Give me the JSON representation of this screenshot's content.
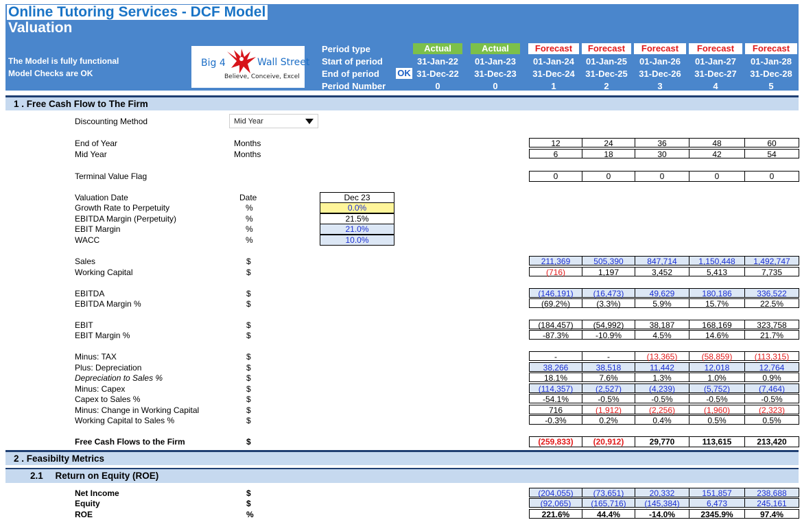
{
  "header": {
    "title": "Online Tutoring Services - DCF Model",
    "subtitle": "Valuation",
    "notes": [
      "The Model is fully functional",
      "Model Checks are OK"
    ],
    "logo": {
      "line1a": "Big 4",
      "line1b": "Wall Street",
      "tagline": "Believe, Conceive, Excel",
      "mark": "eagle-icon"
    },
    "ok_badge": "OK",
    "period_labels": {
      "type": "Period type",
      "start": "Start of period",
      "end": "End of period",
      "number": "Period Number"
    }
  },
  "periods": [
    {
      "type": "Actual",
      "start": "31-Jan-22",
      "end": "31-Dec-22",
      "number": "0"
    },
    {
      "type": "Actual",
      "start": "01-Jan-23",
      "end": "31-Dec-23",
      "number": "0"
    },
    {
      "type": "Forecast",
      "start": "01-Jan-24",
      "end": "31-Dec-24",
      "number": "1"
    },
    {
      "type": "Forecast",
      "start": "01-Jan-25",
      "end": "31-Dec-25",
      "number": "2"
    },
    {
      "type": "Forecast",
      "start": "01-Jan-26",
      "end": "31-Dec-26",
      "number": "3"
    },
    {
      "type": "Forecast",
      "start": "01-Jan-27",
      "end": "31-Dec-27",
      "number": "4"
    },
    {
      "type": "Forecast",
      "start": "01-Jan-28",
      "end": "31-Dec-28",
      "number": "5"
    }
  ],
  "colors": {
    "header_bg": "#4a86cc",
    "title": "#1a74c6",
    "actual": "#7cc04a",
    "forecast_text": "#e11919",
    "section_bg": "#c6d9ef",
    "input_bg": "#dce7f5",
    "input_text": "#1b2fd1"
  },
  "section1": {
    "title": "1 . Free Cash Flow to The Firm",
    "discounting": {
      "label": "Discounting Method",
      "value": "Mid Year"
    },
    "timing": [
      {
        "label": "End of Year",
        "unit": "Months",
        "values": [
          "12",
          "24",
          "36",
          "48",
          "60"
        ]
      },
      {
        "label": "Mid Year",
        "unit": "Months",
        "values": [
          "6",
          "18",
          "30",
          "42",
          "54"
        ]
      }
    ],
    "terminal": {
      "label": "Terminal Value Flag",
      "values": [
        "0",
        "0",
        "0",
        "0",
        "0"
      ]
    },
    "valuation": [
      {
        "label": "Valuation Date",
        "unit": "Date",
        "value": "Dec 23"
      },
      {
        "label": "Growth Rate to Perpetuity",
        "unit": "%",
        "value": "0.0%"
      },
      {
        "label": "EBITDA Margin (Perpetuity)",
        "unit": "%",
        "value": "21.5%"
      },
      {
        "label": "EBIT Margin",
        "unit": "%",
        "value": "21.0%"
      },
      {
        "label": "WACC",
        "unit": "%",
        "value": "10.0%"
      }
    ],
    "rows": [
      {
        "label": "Sales",
        "unit": "$",
        "values": [
          "211,369",
          "505,390",
          "847,714",
          "1,150,448",
          "1,492,747"
        ]
      },
      {
        "label": "Working Capital",
        "unit": "$",
        "values": [
          "(716)",
          "1,197",
          "3,452",
          "5,413",
          "7,735"
        ]
      },
      {
        "label": "EBITDA",
        "unit": "$",
        "values": [
          "(146,191)",
          "(16,473)",
          "49,629",
          "180,186",
          "336,522"
        ]
      },
      {
        "label": "EBITDA Margin %",
        "unit": "$",
        "values": [
          "(69.2%)",
          "(3.3%)",
          "5.9%",
          "15.7%",
          "22.5%"
        ]
      },
      {
        "label": "EBIT",
        "unit": "$",
        "values": [
          "(184,457)",
          "(54,992)",
          "38,187",
          "168,169",
          "323,758"
        ]
      },
      {
        "label": "EBIT Margin %",
        "unit": "$",
        "values": [
          "-87.3%",
          "-10.9%",
          "4.5%",
          "14.6%",
          "21.7%"
        ]
      },
      {
        "label": "Minus: TAX",
        "unit": "$",
        "values": [
          "-",
          "-",
          "(13,365)",
          "(58,859)",
          "(113,315)"
        ]
      },
      {
        "label": "Plus: Depreciation",
        "unit": "$",
        "values": [
          "38,266",
          "38,518",
          "11,442",
          "12,018",
          "12,764"
        ]
      },
      {
        "label": "Depreciation to Sales %",
        "unit": "$",
        "values": [
          "18.1%",
          "7.6%",
          "1.3%",
          "1.0%",
          "0.9%"
        ]
      },
      {
        "label": "Minus: Capex",
        "unit": "$",
        "values": [
          "(114,357)",
          "(2,527)",
          "(4,239)",
          "(5,752)",
          "(7,464)"
        ]
      },
      {
        "label": "Capex to Sales %",
        "unit": "$",
        "values": [
          "-54.1%",
          "-0.5%",
          "-0.5%",
          "-0.5%",
          "-0.5%"
        ]
      },
      {
        "label": "Minus: Change in Working Capital",
        "unit": "$",
        "values": [
          "716",
          "(1,912)",
          "(2,256)",
          "(1,960)",
          "(2,323)"
        ]
      },
      {
        "label": "Working Capital to Sales %",
        "unit": "$",
        "values": [
          "-0.3%",
          "0.2%",
          "0.4%",
          "0.5%",
          "0.5%"
        ]
      },
      {
        "label": "Free Cash Flows to the Firm",
        "unit": "$",
        "values": [
          "(259,833)",
          "(20,912)",
          "29,770",
          "113,615",
          "213,420"
        ]
      }
    ]
  },
  "section2": {
    "title": "2 . Feasibilty Metrics",
    "sub_number": "2.1",
    "sub_title": "Return on Equity (ROE)",
    "rows": [
      {
        "label": "Net Income",
        "unit": "$",
        "values": [
          "(204,055)",
          "(73,651)",
          "20,332",
          "151,857",
          "238,688"
        ]
      },
      {
        "label": "Equity",
        "unit": "$",
        "values": [
          "(92,065)",
          "(165,716)",
          "(145,384)",
          "6,473",
          "245,161"
        ]
      },
      {
        "label": "ROE",
        "unit": "%",
        "values": [
          "221.6%",
          "44.4%",
          "-14.0%",
          "2345.9%",
          "97.4%"
        ]
      }
    ]
  }
}
